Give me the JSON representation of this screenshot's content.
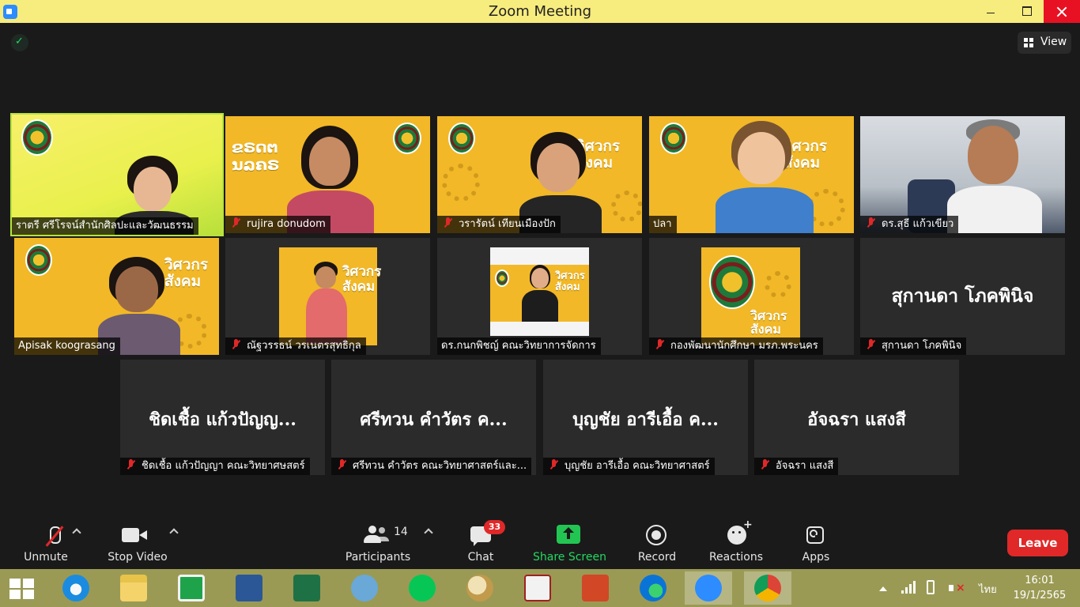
{
  "window": {
    "title": "Zoom Meeting"
  },
  "view_button": {
    "label": "View"
  },
  "participants_row1": [
    {
      "name": "ราตรี   ศรีโรจน์สำนักศิลปะและวัฒนธรรม",
      "muted": false
    },
    {
      "name": "rujira donudom",
      "muted": true
    },
    {
      "name": "วรารัตน์ เทียนเมืองปัก",
      "muted": true
    },
    {
      "name": "ปลา",
      "muted": false
    },
    {
      "name": "ดร.สุธี  แก้วเขียว",
      "muted": true
    }
  ],
  "participants_row2": [
    {
      "name": "Apisak koograsang",
      "muted": false
    },
    {
      "name": "ณัฐวรรธน์ วรเนตรสุทธิกุล",
      "muted": true
    },
    {
      "name": "ดร.กนกพิชญ์ คณะวิทยาการจัดการ",
      "muted": false
    },
    {
      "name": "กองพัฒนานักศึกษา มรภ.พระนคร",
      "muted": true
    },
    {
      "name": "สุกานดา โภคพินิจ",
      "muted": true,
      "display": "สุกานดา โภคพินิจ"
    }
  ],
  "participants_row3": [
    {
      "name": "ชิดเชื้อ แก้วปัญญา คณะวิทยาศษสตร์",
      "display": "ชิดเชื้อ แก้วปัญญ...",
      "muted": true
    },
    {
      "name": "ศรีทวน  คำวัตร คณะวิทยาศาสตร์และ...",
      "display": "ศรีทวน  คำวัตร ค...",
      "muted": true
    },
    {
      "name": "บุญชัย อารีเอื้อ คณะวิทยาศาสตร์",
      "display": "บุญชัย อารีเอื้อ ค...",
      "muted": true
    },
    {
      "name": "อัจฉรา แสงสี",
      "display": "อัจฉรา แสงสี",
      "muted": true
    }
  ],
  "background_text": {
    "headline_top": "วิศวกร",
    "headline_bottom": "สังคม",
    "alt_top": "ຂຣດຕ",
    "alt_bottom": "ນລຄຣ"
  },
  "toolbar": {
    "unmute": "Unmute",
    "stop_video": "Stop Video",
    "participants": "Participants",
    "participants_count": "14",
    "chat": "Chat",
    "chat_badge": "33",
    "share_screen": "Share Screen",
    "record": "Record",
    "reactions": "Reactions",
    "apps": "Apps",
    "leave": "Leave"
  },
  "taskbar": {
    "apps": [
      "windows-start",
      "internet-explorer",
      "file-explorer",
      "store",
      "word",
      "excel",
      "math-input",
      "line",
      "paint",
      "lisrel",
      "powerpoint",
      "edge",
      "zoom",
      "chrome"
    ],
    "language": "ไทย",
    "time": "16:01",
    "date": "19/1/2565"
  },
  "colors": {
    "active_border": "#b6e33c",
    "share_green": "#23c552",
    "leave_red": "#e02828",
    "titlebar": "#f7ec7e",
    "taskbar": "#9a9a55"
  }
}
